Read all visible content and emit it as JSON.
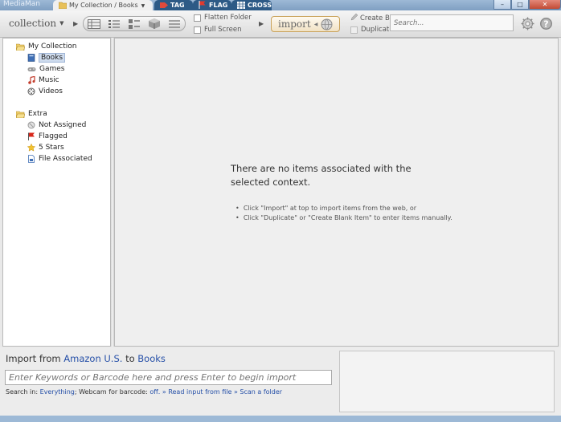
{
  "window": {
    "app_name": "MediaMan",
    "tabs": [
      {
        "label": "My Collection / Books"
      },
      {
        "label": "TAG"
      },
      {
        "label": "FLAG"
      },
      {
        "label": "CROSS"
      }
    ],
    "controls": {
      "minimize": "–",
      "maximize": "□",
      "close": "✕"
    }
  },
  "toolbar": {
    "collection_label": "collection",
    "flatten_folder": "Flatten Folder",
    "full_screen": "Full Screen",
    "import_label": "import",
    "create_blank": "Create B",
    "duplicate": "Duplicat",
    "search_placeholder": "Search..."
  },
  "sidebar": {
    "my_collection": {
      "label": "My Collection",
      "items": [
        {
          "label": "Books",
          "selected": true,
          "icon": "book-icon"
        },
        {
          "label": "Games",
          "icon": "gamepad-icon"
        },
        {
          "label": "Music",
          "icon": "music-icon"
        },
        {
          "label": "Videos",
          "icon": "film-reel-icon"
        }
      ]
    },
    "extra": {
      "label": "Extra",
      "items": [
        {
          "label": "Not Assigned",
          "icon": "not-assigned-icon"
        },
        {
          "label": "Flagged",
          "icon": "flag-icon"
        },
        {
          "label": "5 Stars",
          "icon": "star-icon"
        },
        {
          "label": "File Associated",
          "icon": "file-icon"
        }
      ]
    }
  },
  "main": {
    "empty_message": "There are no items associated with the selected context.",
    "hints": [
      "Click \"Import\" at top to import items from the web, or",
      "Click \"Duplicate\" or \"Create Blank Item\" to enter items manually."
    ]
  },
  "import_panel": {
    "prefix": "Import from",
    "source": "Amazon U.S.",
    "to": "to",
    "target": "Books",
    "keyword_placeholder": "Enter Keywords or Barcode here and press Enter to begin import",
    "search_in_label": "Search in:",
    "search_in_value": "Everything",
    "webcam_label": "; Webcam for barcode:",
    "webcam_value": "off.",
    "read_input": "» Read input from file",
    "scan_folder": "» Scan a folder"
  },
  "colors": {
    "title_bar": "#8faccd",
    "tab_dark": "#2d5a86",
    "link": "#2650a8",
    "selection": "#cfdcee"
  }
}
